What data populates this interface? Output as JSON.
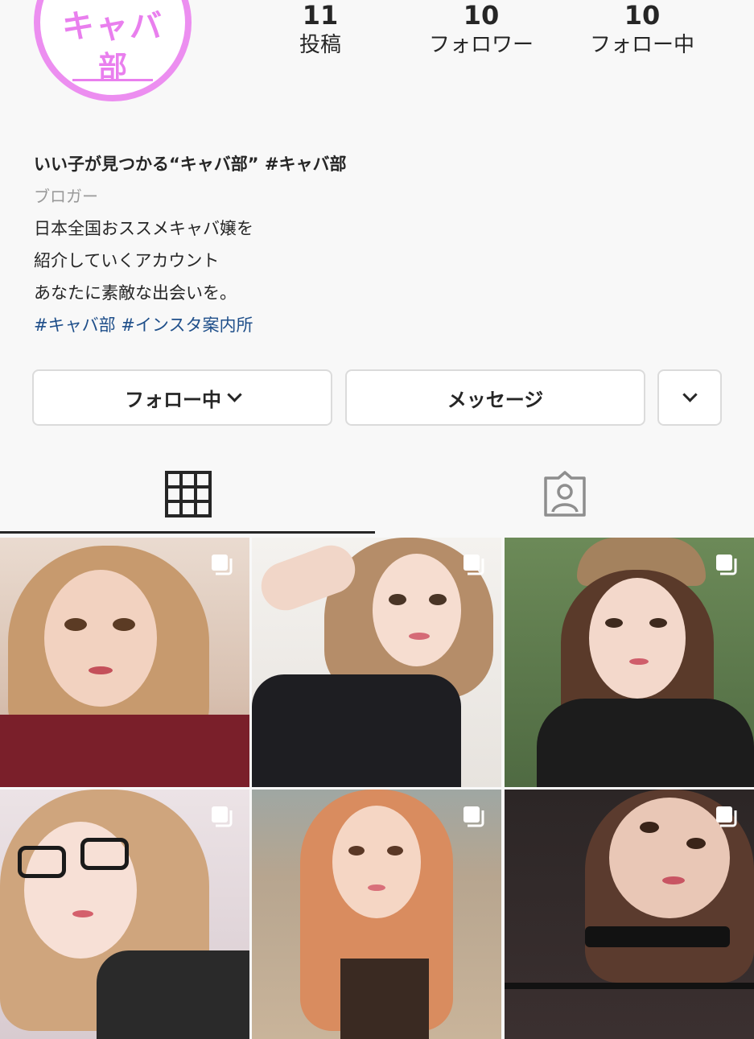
{
  "profile": {
    "avatar_text_line1": "キャバ",
    "avatar_text_line2": "部",
    "stats": {
      "posts_count": "11",
      "posts_label": "投稿",
      "followers_count": "10",
      "followers_label": "フォロワー",
      "following_count": "10",
      "following_label": "フォロー中"
    },
    "name": "いい子が見つかる“キャバ部” #キャバ部",
    "category": "ブロガー",
    "bio_lines": [
      "日本全国おススメキャバ嬢を",
      "紹介していくアカウント",
      "あなたに素敵な出会いを。"
    ],
    "hashtags": "#キャバ部 #インスタ案内所"
  },
  "buttons": {
    "following_label": "フォロー中",
    "message_label": "メッセージ"
  },
  "tabs": {
    "active": "grid",
    "items": [
      "grid-icon",
      "tagged-icon"
    ]
  },
  "posts": [
    {
      "type": "carousel",
      "icon": "multiple-photos-icon",
      "palette": [
        "#e8d5c8",
        "#c9a07a",
        "#7a1f2a"
      ]
    },
    {
      "type": "carousel",
      "icon": "multiple-photos-icon",
      "palette": [
        "#efece8",
        "#b38a66",
        "#1e1e22"
      ]
    },
    {
      "type": "carousel",
      "icon": "multiple-photos-icon",
      "palette": [
        "#6d8a5a",
        "#c7a07e",
        "#1c1c1c"
      ]
    },
    {
      "type": "carousel",
      "icon": "multiple-photos-icon",
      "palette": [
        "#e8dfe3",
        "#caa37c",
        "#2a2a2a"
      ]
    },
    {
      "type": "carousel",
      "icon": "multiple-photos-icon",
      "palette": [
        "#b9a58d",
        "#d98c5f",
        "#3a2a22"
      ]
    },
    {
      "type": "carousel",
      "icon": "multiple-photos-icon",
      "palette": [
        "#2c2626",
        "#caa089",
        "#121212"
      ]
    }
  ],
  "colors": {
    "avatar_ring": "#ec8ef0",
    "hashtag": "#1f4f8a",
    "border": "#dbdbdb",
    "background": "#f8f8f8"
  }
}
